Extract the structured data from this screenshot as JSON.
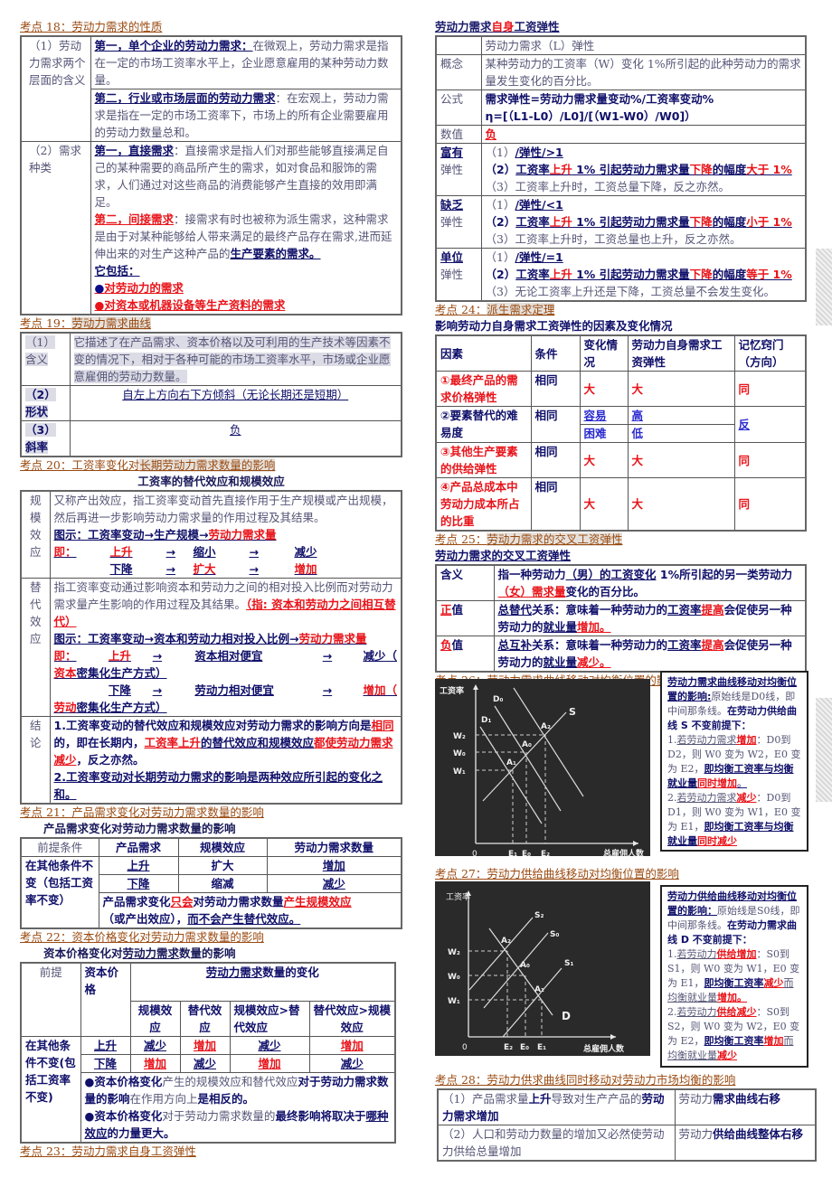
{
  "s18": {
    "title": "考点 18：劳动力需求的性质",
    "row1_label": "（1）劳动力需求两个层面的含义",
    "row1a_head": "第一，单个企业的劳动力需求：",
    "row1a_text": "在微观上，劳动力需求是指在一定的市场工资率水平上，企业愿意雇用的某种劳动力数量。",
    "row1b_head": "第二，行业或市场层面的劳动力需求",
    "row1b_text": "：在宏观上，劳动力需求是指在一定的市场工资率下，市场上的所有企业需要雇用的劳动力数量总和。",
    "row2_label": "（2）需求种类",
    "row2a_head": "第一，直接需求",
    "row2a_text": "：直接需求是指人们对那些能够直接满足自己的某种需要的商品所产生的需求，如对食品和服饰的需求，人们通过对这些商品的消费能够产生直接的效用即满足。",
    "row2b_head": "第二，间接需求",
    "row2b_text": "：接需求有时也被称为派生需求，这种需求是由于对某种能够给人带来满足的最终产品存在需求,进而延伸出来的对生产这种产品的",
    "row2b_key": "生产要素的需求。",
    "row2b_includes": "它包括：",
    "bullet1": "对劳动力的需求",
    "bullet2": "对资本或机器设备等生产资料的需求",
    "bullet_glyph": "●"
  },
  "s19": {
    "title_prefix": "考点 19：",
    "title_hl": "劳动力需求曲线",
    "r1_label": "（1）含义",
    "r1_text": "它描述了在产品需求、资本价格以及可利用的生产技术等因素不变的情况下，相对于各种可能的市场工资率水平，市场或企业愿意雇佣的劳动力数量。",
    "r2_label": "（2）形状",
    "r2_text": "自左上方向右下方倾斜（无论长期还是短期）",
    "r3_label": "（3）斜率",
    "r3_text": "负"
  },
  "s20": {
    "title_prefix": "考点 20：工资率变化对",
    "title_hl": "长期劳动力需求数量的影响",
    "subtitle": "工资率的替代效应和规模效应",
    "scale_label": "规模效应",
    "scale_def": "又称产出效应，指工资率变动首先直接作用于生产规模或产出规模，然后再进一步影响劳动力需求量的作用过程及其结果。",
    "scale_diagram_a": "图示：工资率变动→生产规模→",
    "scale_diagram_b": "劳动力需求量",
    "scale_l1": [
      "即：",
      "上升",
      "→",
      "缩小",
      "→",
      "减少"
    ],
    "scale_l2": [
      "",
      "下降",
      "→",
      "扩大",
      "→",
      "增加"
    ],
    "sub_label": "替代效应",
    "sub_def": "指工资率变动通过影响资本和劳动力之间的相对投入比例而对劳动力需求量产生影响的作用过程及其结果。",
    "sub_def_red": "（指: 资本和劳动力之间相互替代）",
    "sub_diagram_a": "图示：工资率变动→资本和劳动力相对投入比例→",
    "sub_diagram_b": "劳动力需求量",
    "sub_l1": [
      "即：",
      "上升",
      "→",
      "资本相对便宜",
      "→",
      "减少（",
      "资本",
      "密集化生产方式）"
    ],
    "sub_l2": [
      "",
      "下降",
      "→",
      "劳动力相对便宜",
      "→",
      "增加（",
      "劳动",
      "密集化生产方式）"
    ],
    "concl_label": "结论",
    "concl_1a": "1.工资率变动的替代效应和规模效应对劳动力需求的影响方向是",
    "concl_1b": "相同",
    "concl_1c": "的，即在长期内，",
    "concl_1d": "工资率上升",
    "concl_1e": "的替代效应和规模效应",
    "concl_1f": "都使劳动力需求减少",
    "concl_1g": "，反之亦然。",
    "concl_2": "2.工资率变动对长期劳动力需求的影响是两种效应所引起的变化之和。"
  },
  "s21": {
    "title": "考点 21：产品需求变化对劳动力需求数量的影响",
    "subtitle": "产品需求变化对劳动力需求数量的影响",
    "headers": [
      "前提条件",
      "产品需求",
      "规模效应",
      "劳动力需求数量"
    ],
    "premise": "在其他条件不变（包括工资率不变）",
    "rows": [
      [
        "上升",
        "扩大",
        "增加"
      ],
      [
        "下降",
        "缩减",
        "减少"
      ]
    ],
    "note_a": "产品需求变化",
    "note_b": "只会",
    "note_c": "对劳动力需求数量",
    "note_d": "产生规模效应",
    "note_e": "（或产出效应），",
    "note_f": "而不会产生替代效应。"
  },
  "s22": {
    "title": "考点 22：资本价格变化对劳动力需求数量的影响",
    "subtitle_a": "资本价格变化对",
    "subtitle_b": "劳动力需求",
    "subtitle_c": "数量的影响",
    "h_premise": "前提",
    "h_capital": "资本价格",
    "h_change_a": "劳动力需求",
    "h_change_b": "数量的变化",
    "sub_headers": [
      "规模效应",
      "替代效应",
      "规模效应>替代效应",
      "替代效应>规模效应"
    ],
    "premise": "在其他条件不变(包括工资率不变)",
    "rows": [
      {
        "price": "上升",
        "vals": [
          "减少",
          "增加",
          "减少",
          "增加"
        ]
      },
      {
        "price": "下降",
        "vals": [
          "增加",
          "减少",
          "增加",
          "减少"
        ]
      }
    ],
    "note1_a": "●资本价格变化",
    "note1_b": "产生的规模效应和替代效应",
    "note1_c": "对于劳动力需求数量的影响",
    "note1_d": "在作用方向上",
    "note1_e": "是相反的。",
    "note2_a": "●资本价格变化",
    "note2_b": "对于劳动力需求数量的",
    "note2_c": "最终影响将取决于",
    "note2_d": "哪种效应",
    "note2_e": "的力量更大。"
  },
  "s23": {
    "title": "考点 23：劳动力需求自身工资弹性"
  },
  "elasticity": {
    "title_a": "劳动力需求",
    "title_b": "自身",
    "title_c": "工资弹性",
    "head": "劳动力需求（L）弹性",
    "concept_label": "概念",
    "concept_text": "某种劳动力的工资率（W）变化 1%所引起的此种劳动力的需求量发生变化的百分比。",
    "formula_label": "公式",
    "formula_1": "需求弹性=劳动力需求量变动%/工资率变动%",
    "formula_2": "η=[（L1-L0）/L0]/[（W1-W0）/W0]）",
    "value_label": "数值",
    "value_text": "负",
    "types": [
      {
        "label_a": "富有",
        "label_b": "弹性",
        "l1": "（1）",
        "l1u": "/弹性/>1",
        "l2_cmp": "大于 1%",
        "l3": "（3）工资率上升时，工资总量下降，反之亦然。"
      },
      {
        "label_a": "缺乏",
        "label_b": "弹性",
        "l1": "（1）",
        "l1u": "/弹性/<1",
        "l2_cmp": "小于 1%",
        "l3": "（3）工资率上升时，工资总量也上升，反之亦然。"
      },
      {
        "label_a": "单位",
        "label_b": "弹性",
        "l1": "（1）",
        "l1u": "/弹性/=1",
        "l2_cmp": "等于 1%",
        "l3": "（3）无论工资率上升还是下降，工资总量不会发生变化。"
      }
    ],
    "l2_a": "（2）",
    "l2_b": "工资率",
    "l2_c": "上升",
    "l2_d": " 1% 引起劳动力需求量",
    "l2_e": "下降",
    "l2_f": "的幅度"
  },
  "s24": {
    "title_prefix": "考点 24：",
    "title_hl": "派生需求定理",
    "subtitle": "影响劳动力自身需求工资弹性的因素及变化情况",
    "headers": [
      "因素",
      "条件",
      "变化情况",
      "劳动力自身需求工资弹性",
      "记忆窍门（方向）"
    ],
    "rows": [
      {
        "factor": "①最终产品的需求价格弹性",
        "cond": "相同",
        "change": "大",
        "elast": "大",
        "tip": "同"
      },
      {
        "factor": "②要素替代的难易度",
        "cond": "相同",
        "change": "容易",
        "change2": "困难",
        "elast": "高",
        "elast2": "低",
        "tip": "反"
      },
      {
        "factor": "③其他生产要素的供给弹性",
        "cond": "相同",
        "change": "大",
        "elast": "大",
        "tip": "同"
      },
      {
        "factor": "④产品总成本中劳动力成本所占的比重",
        "cond": "相同",
        "change": "大",
        "elast": "大",
        "tip": "同"
      }
    ]
  },
  "s25": {
    "title_prefix": "考点 25：",
    "title_hl": "劳动力需求的交叉工资弹性",
    "subtitle": "劳动力需求的交叉工资弹性",
    "meaning_label": "含义",
    "meaning_a": "指一种劳动力",
    "meaning_b": "（男）的工资变化",
    "meaning_c": " 1%所引起的另一类劳动力",
    "meaning_d": "（女）需求量",
    "meaning_e": "变化的百分比。",
    "pos_label_a": "正",
    "pos_label_b": "值",
    "pos_a": "总替代",
    "pos_b": "关系：意味着一种劳动力的",
    "pos_c": "工资率",
    "pos_d": "提高",
    "pos_e": "会促使另一种劳动力的",
    "pos_f": "就业量",
    "pos_g": "增加。",
    "neg_label_a": "负",
    "neg_label_b": "值",
    "neg_a": "总互补",
    "neg_b": "关系：意味着一种劳动力的",
    "neg_c": "工资率",
    "neg_d": "提高",
    "neg_e": "会促使另一种劳动力的",
    "neg_f": "就业量",
    "neg_g": "减少。"
  },
  "s26": {
    "title_prefix": "考点 26：劳动力",
    "title_u": "需求曲线移动",
    "title_suffix": "对均衡位置的影响",
    "chart": {
      "ylabel": "工资率",
      "xlabel": "总雇佣人数",
      "origin": "0",
      "y_ticks": [
        "W₂",
        "W₀",
        "W₁"
      ],
      "x_ticks": [
        "E₁",
        "E₀",
        "E₂"
      ],
      "curves": [
        "D₀",
        "D₁",
        "S"
      ],
      "points": [
        "A₂",
        "A₀",
        "A₁"
      ]
    },
    "note_head": "劳动力需求曲线移动对均衡位置的影响:",
    "note_a": "原始线是D0线，即中间那条线。",
    "note_b": "在劳动力供给曲线 S 不变前提下：",
    "note_1a": "1.",
    "note_1b": "若劳动力需求",
    "note_1c": "增加",
    "note_1d": "：D0到D2，则 W0 变为 W2，E0 变为 E2，",
    "note_1e": "即均衡工资率与均衡就业量",
    "note_1f": "同时增加",
    "note_1g": "。",
    "note_2a": "2.",
    "note_2b": "若劳动力需求",
    "note_2c": "减少",
    "note_2d": "：D0到 D1，则 W0 变为 W1，E0 变为 E1，",
    "note_2e": "即均衡工资率与均衡就业量",
    "note_2f": "同时减少"
  },
  "s27": {
    "title_prefix": "考点 27：劳动力",
    "title_u": "供给曲线移动",
    "title_suffix": "对均衡位置的影响",
    "chart": {
      "ylabel": "工资率",
      "xlabel": "总雇佣人数",
      "origin": "0",
      "y_ticks": [
        "W₂",
        "W₀",
        "W₁"
      ],
      "x_ticks": [
        "E₂",
        "E₀",
        "E₁"
      ],
      "curves": [
        "S₂",
        "S₀",
        "S₁",
        "D"
      ],
      "points": [
        "A₂",
        "A₀",
        "A₁"
      ]
    },
    "note_head": "劳动力供给曲线移动对均衡位置的影响：",
    "note_a": "原始线是S0线，即中间那条线。",
    "note_b": "在劳动力需求曲线 D 不变前提下：",
    "note_1a": "1.",
    "note_1b": "若劳动力",
    "note_1c": "供给增加",
    "note_1d": "：S0到S1，则 W0 变为 W1，E0 变为 E1，",
    "note_1e": "即均衡工资率",
    "note_1f": "减少",
    "note_1g": "而均衡就业量",
    "note_1h": "增加。",
    "note_2a": "2.",
    "note_2b": "若劳动力",
    "note_2c": "供给减少",
    "note_2d": "：S0到S2，则 W0 变为 W2，E0 变为 E2，",
    "note_2e": "即均衡工资率",
    "note_2f": "增加",
    "note_2g": "而均衡就业量",
    "note_2h": "减少"
  },
  "s28": {
    "title_prefix": "考点 28：劳动力",
    "title_u": "供求曲线同时移动",
    "title_suffix": "对劳动力市场均衡的影响",
    "r1_a": "（1）产品需求量",
    "r1_b": "上升",
    "r1_c": "导致对生产产品的",
    "r1_d": "劳动力需求增加",
    "r1_right_a": "劳动力",
    "r1_right_b": "需求曲线右移",
    "r2_a": "（2）人口和劳动力数量的增加又必然使劳动力供给总量增加",
    "r2_right_a": "劳动力",
    "r2_right_b": "供给曲线整体右移"
  }
}
